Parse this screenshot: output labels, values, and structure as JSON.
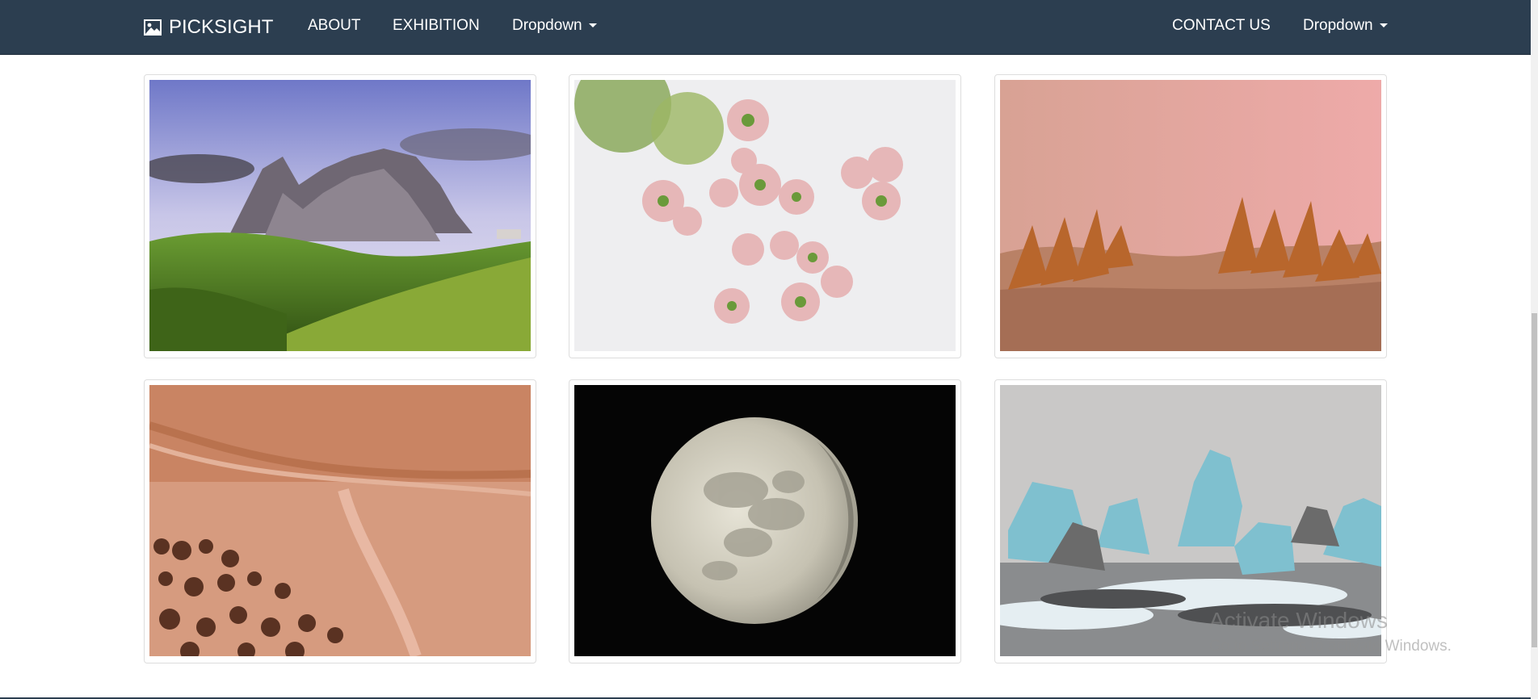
{
  "navbar": {
    "brand": "PICKSIGHT",
    "brand_icon": "image-icon",
    "left_links": [
      "ABOUT",
      "EXHIBITION"
    ],
    "left_dropdown": "Dropdown",
    "right_links": [
      "CONTACT US"
    ],
    "right_dropdown": "Dropdown",
    "background": "#2c3e50"
  },
  "gallery": {
    "items": [
      {
        "subject": "mountain-landscape"
      },
      {
        "subject": "pink-flowers"
      },
      {
        "subject": "sand-dune-grass"
      },
      {
        "subject": "aerial-desert"
      },
      {
        "subject": "moon"
      },
      {
        "subject": "glacier-ice"
      }
    ]
  },
  "watermark": {
    "title": "Activate Windows",
    "subtitle": "Go to Settings to activate Windows."
  }
}
